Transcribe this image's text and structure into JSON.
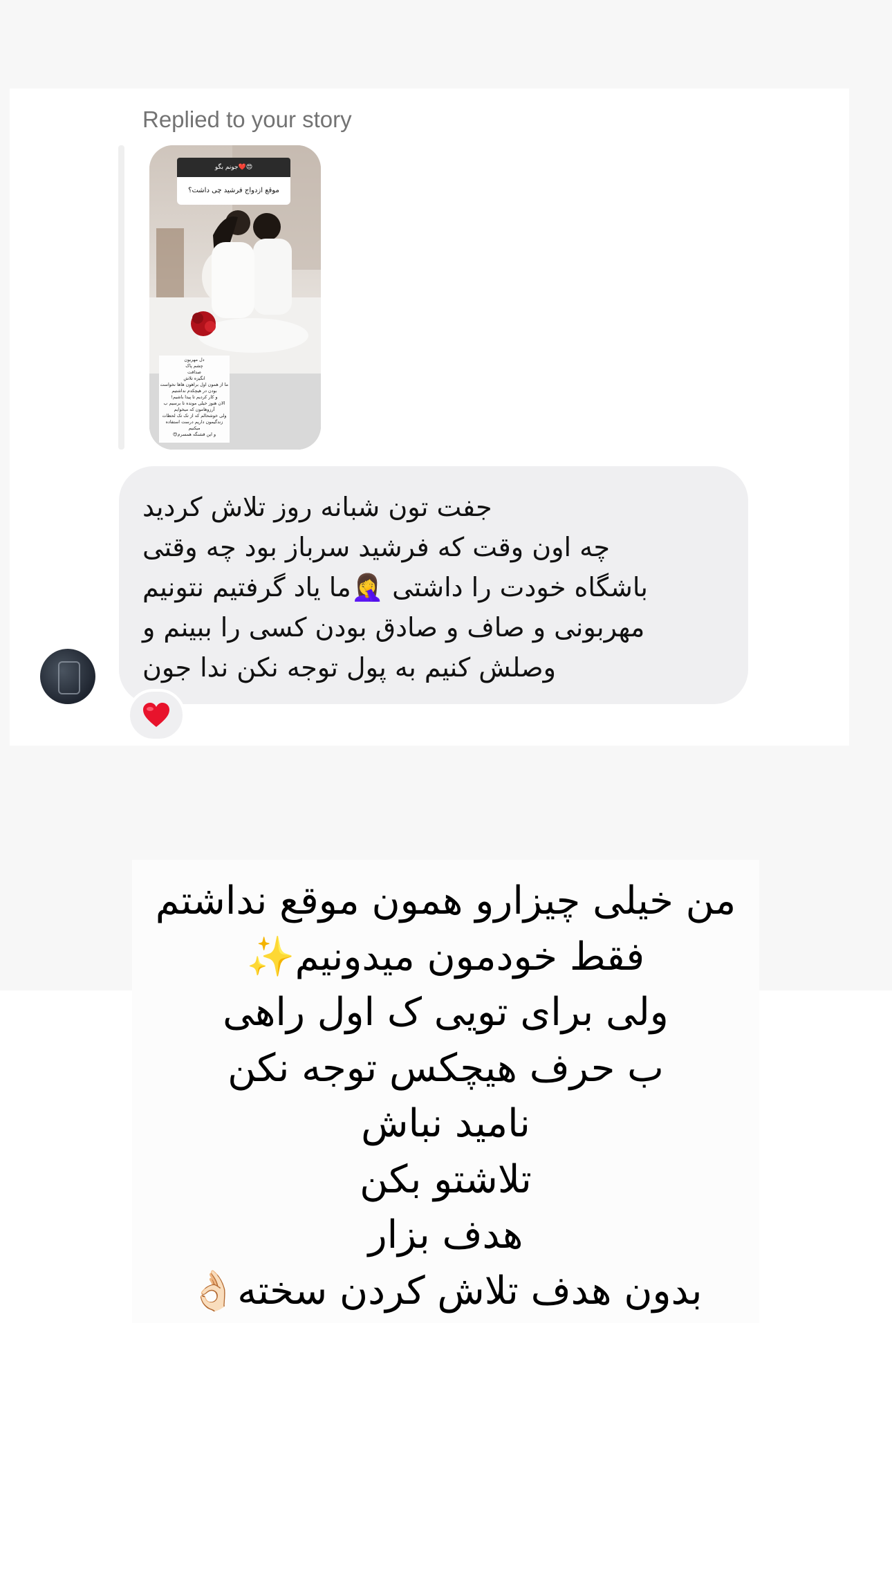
{
  "conversation": {
    "reply_label": "Replied to your story",
    "story": {
      "question_header": "جونم بگو❤️😍",
      "question_text": "موقع ازدواج فرشید چی داشت؟",
      "note_lines": [
        "دل مهربون",
        "چشم پاک",
        "صداقت",
        "انگیزه تلاش",
        "ما از همون اول براهون هاها نخواست",
        "بودن در هیچکدم نداشتیم",
        "و کار کردیم تا پیدا باشیم!",
        "الان هنوز خیلی مونده تا برسیم ب",
        "آرزوهامون که میخوایم",
        "ولی خوشحالم که از تک تک لحظات",
        "زندگیمون داریم درست استفاده",
        "میکنیم",
        "و این قشنگه همسرم😍"
      ]
    },
    "message": {
      "lines": [
        "جفت تون شبانه روز تلاش کردید",
        "چه اون وقت که فرشید سرباز بود چه وقتی",
        "باشگاه خودت را داشتی 🤦‍♀️ما یاد گرفتیم نتونیم",
        "مهربونی و صاف و صادق بودن کسی را ببینم و",
        "وصلش کنیم به پول توجه نکن ندا جون"
      ]
    },
    "reaction": "❤️"
  },
  "note": {
    "lines": [
      "من خیلی چیزارو همون موقع نداشتم",
      "فقط خودمون میدونیم✨",
      "ولی برای تویی ک اول راهی",
      "ب حرف هیچکس توجه نکن",
      "نامید نباش",
      "تلاشتو بکن",
      "هدف بزار",
      "بدون هدف تلاش کردن سخته👌🏻"
    ]
  },
  "colors": {
    "bubble": "#efeff1",
    "label": "#737373",
    "background": "#f7f7f7"
  }
}
